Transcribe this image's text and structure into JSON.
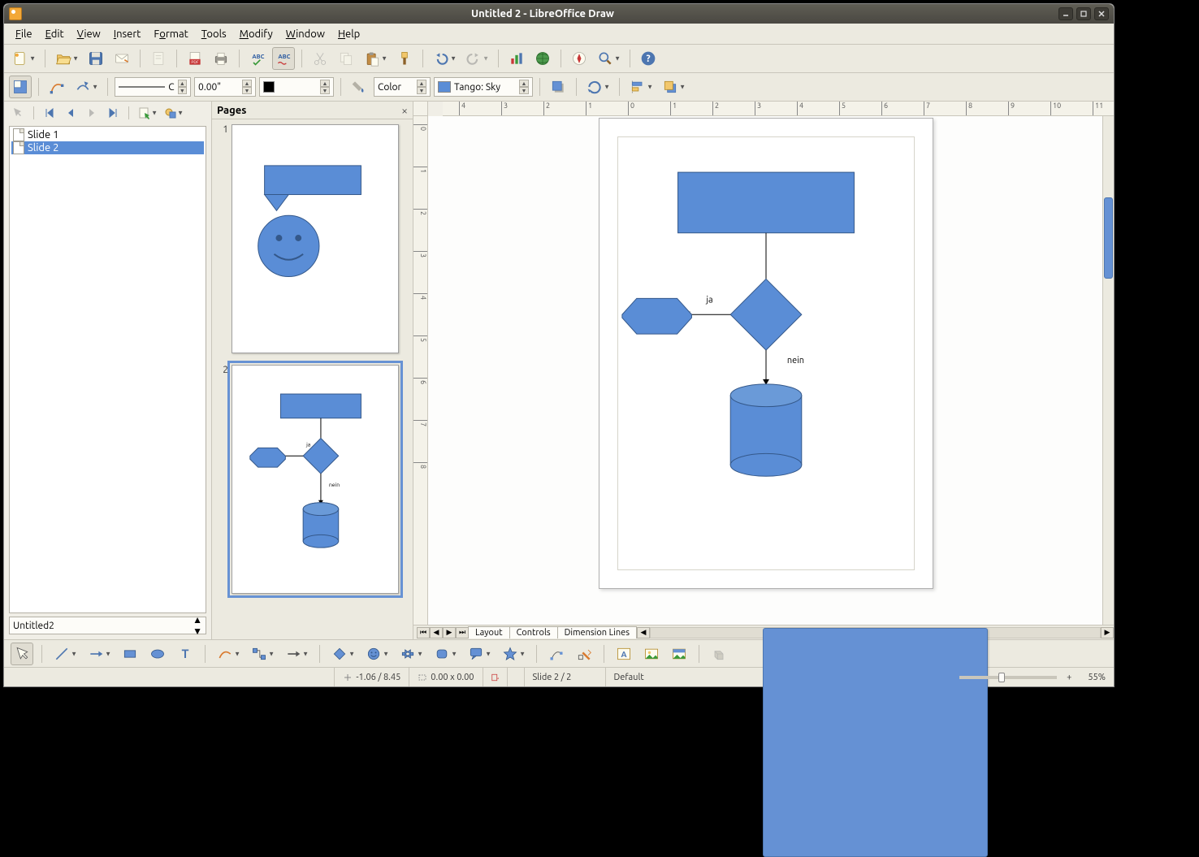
{
  "window": {
    "title": "Untitled 2 - LibreOffice Draw"
  },
  "menu": {
    "file": "File",
    "edit": "Edit",
    "view": "View",
    "insert": "Insert",
    "format": "Format",
    "tools": "Tools",
    "modify": "Modify",
    "window": "Window",
    "help": "Help"
  },
  "toolbar2": {
    "line_style": "C",
    "line_width": "0.00\"",
    "area_fill_type": "Color",
    "area_fill_value": "Tango: Sky"
  },
  "fill_swatch_color": "#5a8dd6",
  "slide_tree": {
    "items": [
      {
        "label": "Slide 1",
        "selected": false
      },
      {
        "label": "Slide 2",
        "selected": true
      }
    ],
    "layer_combo": "Untitled2"
  },
  "pages_panel": {
    "title": "Pages",
    "thumbs": [
      {
        "num": "1",
        "selected": false
      },
      {
        "num": "2",
        "selected": true
      }
    ]
  },
  "ruler_ticks_h": [
    "4",
    "3",
    "2",
    "1",
    "0",
    "1",
    "2",
    "3",
    "4",
    "5",
    "6",
    "7",
    "8",
    "9",
    "10",
    "11"
  ],
  "ruler_ticks_v": [
    "0",
    "1",
    "2",
    "3",
    "4",
    "5",
    "6",
    "7",
    "8"
  ],
  "flowchart": {
    "label_yes": "ja",
    "label_no": "nein"
  },
  "bottom_tabs": {
    "layout": "Layout",
    "controls": "Controls",
    "dim": "Dimension Lines"
  },
  "status": {
    "pos": "-1.06 / 8.45",
    "size": "0.00 x 0.00",
    "slide": "Slide 2 / 2",
    "style": "Default",
    "zoom": "55%"
  },
  "shape_color": "#5a8dd6",
  "shape_border": "#34588a"
}
